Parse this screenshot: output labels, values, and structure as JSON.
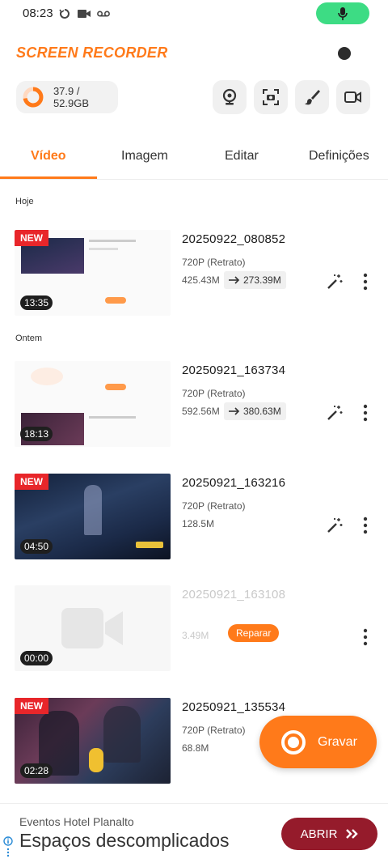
{
  "status_bar": {
    "time": "08:23"
  },
  "header": {
    "logo": "SCREEN RECORDER",
    "storage": "37.9 / 52.9GB",
    "storage_used_fraction": 0.72,
    "accent_color": "#ff7a1a"
  },
  "tabs": [
    {
      "label": "Vídeo",
      "active": true
    },
    {
      "label": "Imagem",
      "active": false
    },
    {
      "label": "Editar",
      "active": false
    },
    {
      "label": "Definições",
      "active": false
    }
  ],
  "sections": {
    "today": "Hoje",
    "yesterday": "Ontem"
  },
  "videos": [
    {
      "title": "20250922_080852",
      "resolution": "720P (Retrato)",
      "size": "425.43M",
      "compressed": "273.39M",
      "duration": "13:35",
      "badge": "NEW"
    },
    {
      "title": "20250921_163734",
      "resolution": "720P (Retrato)",
      "size": "592.56M",
      "compressed": "380.63M",
      "duration": "18:13",
      "badge": ""
    },
    {
      "title": "20250921_163216",
      "resolution": "720P (Retrato)",
      "size": "128.5M",
      "duration": "04:50",
      "badge": "NEW"
    },
    {
      "title": "20250921_163108",
      "size": "3.49M",
      "duration": "00:00",
      "repair": "Reparar"
    },
    {
      "title": "20250921_135534",
      "resolution": "720P (Retrato)",
      "size": "68.8M",
      "duration": "02:28",
      "badge": "NEW"
    }
  ],
  "record_button": {
    "label": "Gravar"
  },
  "ad": {
    "sponsor": "Eventos Hotel Planalto",
    "headline": "Espaços descomplicados",
    "cta": "ABRIR"
  }
}
